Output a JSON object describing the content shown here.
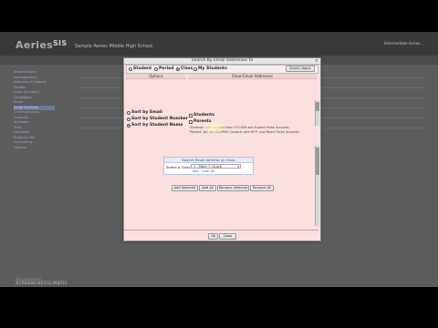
{
  "app": {
    "logo_text": "Aeries",
    "logo_version": "SIS",
    "school_name": "Sample Aeries Middle High School",
    "user_label": "Intermediate Aeries..."
  },
  "sidebar": {
    "items": [
      {
        "label": "Student Data"
      },
      {
        "label": "Demographics"
      },
      {
        "label": "Attendance Options"
      },
      {
        "label": "Grades"
      },
      {
        "label": "Class Summary"
      },
      {
        "label": "Gradebook"
      },
      {
        "label": "Email"
      },
      {
        "label": "Email Students"
      },
      {
        "label": "Communication"
      },
      {
        "label": "Contacts"
      },
      {
        "label": "Schedule"
      },
      {
        "label": "Tests"
      },
      {
        "label": "Discipline"
      },
      {
        "label": "Progress Rpt"
      },
      {
        "label": "Counseling"
      },
      {
        "label": "Options"
      }
    ]
  },
  "dialog": {
    "title": "Search By Email Addresses To",
    "close": "×",
    "radios": [
      {
        "label": "Student",
        "selected": false
      },
      {
        "label": "Period",
        "selected": false
      },
      {
        "label": "Class",
        "selected": true
      },
      {
        "label": "My Students",
        "selected": false
      }
    ],
    "search_btn": "Search Again",
    "options_header": "Options",
    "show_header": "Show Email Addresses",
    "sort_options": [
      {
        "label": "Sort by Email",
        "selected": false
      },
      {
        "label": "Sort by Student Number",
        "selected": false
      },
      {
        "label": "Sort by Student Name",
        "selected": true
      }
    ],
    "group_options": [
      {
        "label": "Students",
        "selected": false
      },
      {
        "label": "Parents",
        "selected": false
      }
    ],
    "note_line1": "\"Students\" will use email from STU.SEM and Student Portal Accounts.",
    "note_line2": "\"Parents\" will use STU.PEM, Contacts with MT**, and Parent Portal Accounts.",
    "search_box": {
      "title": "Search Email Address by Class",
      "label": "Select a Class",
      "select_value": "1 - Math 7 (Scott)",
      "links": "Add  ·  Clear All"
    },
    "actions": [
      "Add Selected",
      "Add All",
      "Remove Selected",
      "Remove All"
    ],
    "footer_buttons": [
      "OK",
      "Close"
    ]
  },
  "watermark": {
    "line1": "Recorded with",
    "line2": "SCREENCAST-O-MATIC"
  }
}
